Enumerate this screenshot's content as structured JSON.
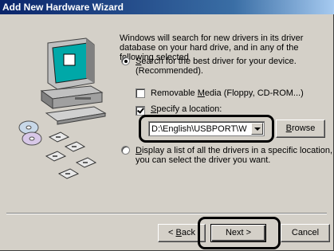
{
  "window": {
    "title": "Add New Hardware Wizard"
  },
  "intro_text": "Windows will search for new drivers in its driver database on your hard drive, and in any of the following selected",
  "search_option": {
    "label_pre": "",
    "label_accel": "S",
    "label_post": "earch for the best driver for your device.",
    "label_line2": "(Recommended).",
    "selected": true
  },
  "removable_media": {
    "label_pre": "Removable ",
    "label_accel": "M",
    "label_post": "edia (Floppy, CD-ROM...)",
    "checked": false
  },
  "specify_location": {
    "label_pre": "",
    "label_accel": "S",
    "label_post": "pecify a location:",
    "checked": true
  },
  "location_combo": {
    "value": "D:\\English\\USBPORT\\Win"
  },
  "browse_button": {
    "label_pre": "",
    "label_accel": "B",
    "label_post": "rowse"
  },
  "list_option": {
    "label_pre": "",
    "label_accel": "D",
    "label_post": "isplay a list of all the drivers in a specific location, so",
    "label_line2": "you can select the driver you want.",
    "selected": false
  },
  "footer": {
    "back_pre": "< ",
    "back_accel": "B",
    "back_post": "ack",
    "next_label": "Next >",
    "cancel_label": "Cancel"
  },
  "icons": {
    "wizard_art": "computer-with-floppy-disks-and-cds",
    "combo_arrow": "chevron-down-icon"
  }
}
